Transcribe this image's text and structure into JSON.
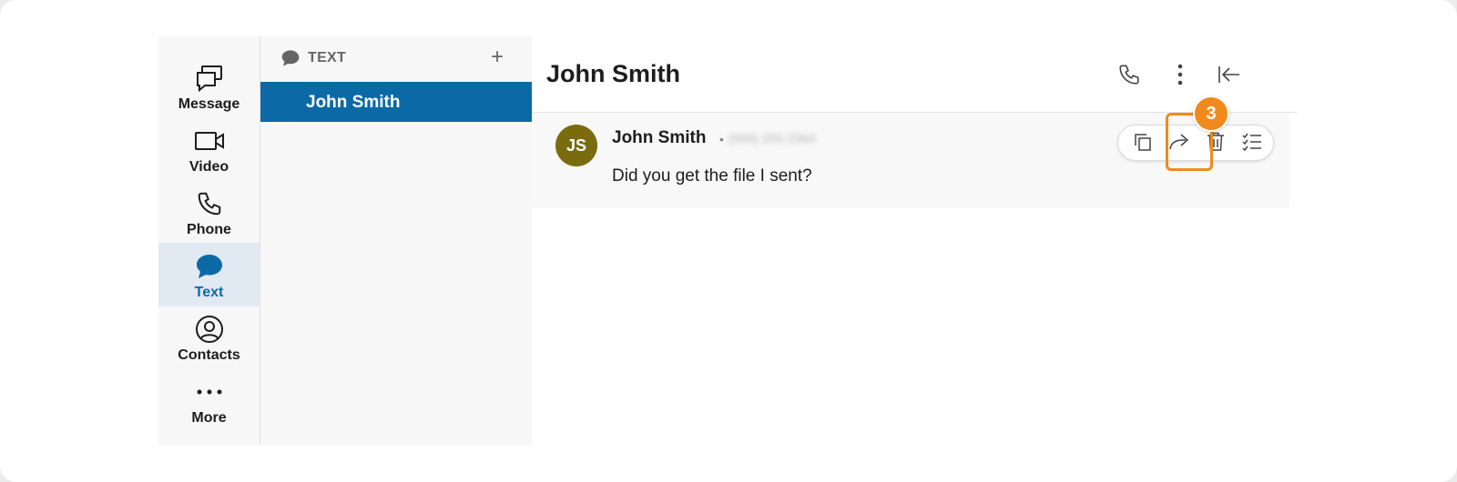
{
  "nav": {
    "items": [
      {
        "label": "Message",
        "icon": "message-icon"
      },
      {
        "label": "Video",
        "icon": "video-icon"
      },
      {
        "label": "Phone",
        "icon": "phone-icon"
      },
      {
        "label": "Text",
        "icon": "text-bubble-icon",
        "active": true
      },
      {
        "label": "Contacts",
        "icon": "contacts-icon"
      },
      {
        "label": "More",
        "icon": "more-dots-icon"
      }
    ]
  },
  "list": {
    "header_title": "TEXT",
    "add_icon": "+",
    "conversations": [
      {
        "name": "John Smith",
        "selected": true
      }
    ]
  },
  "conversation": {
    "title": "John Smith",
    "header_actions": [
      "phone-icon",
      "kebab-menu-icon",
      "collapse-panel-icon"
    ],
    "messages": [
      {
        "avatar_initials": "JS",
        "sender": "John Smith",
        "separator": "•",
        "phone": "(909) 200-2364",
        "text": "Did you get the file I sent?"
      }
    ],
    "message_actions": [
      "copy-icon",
      "forward-icon",
      "delete-icon",
      "select-icon"
    ]
  },
  "annotation": {
    "step": "3"
  },
  "colors": {
    "accent": "#0b6aa6",
    "avatar": "#7a6b0f",
    "highlight": "#f08a1c"
  }
}
